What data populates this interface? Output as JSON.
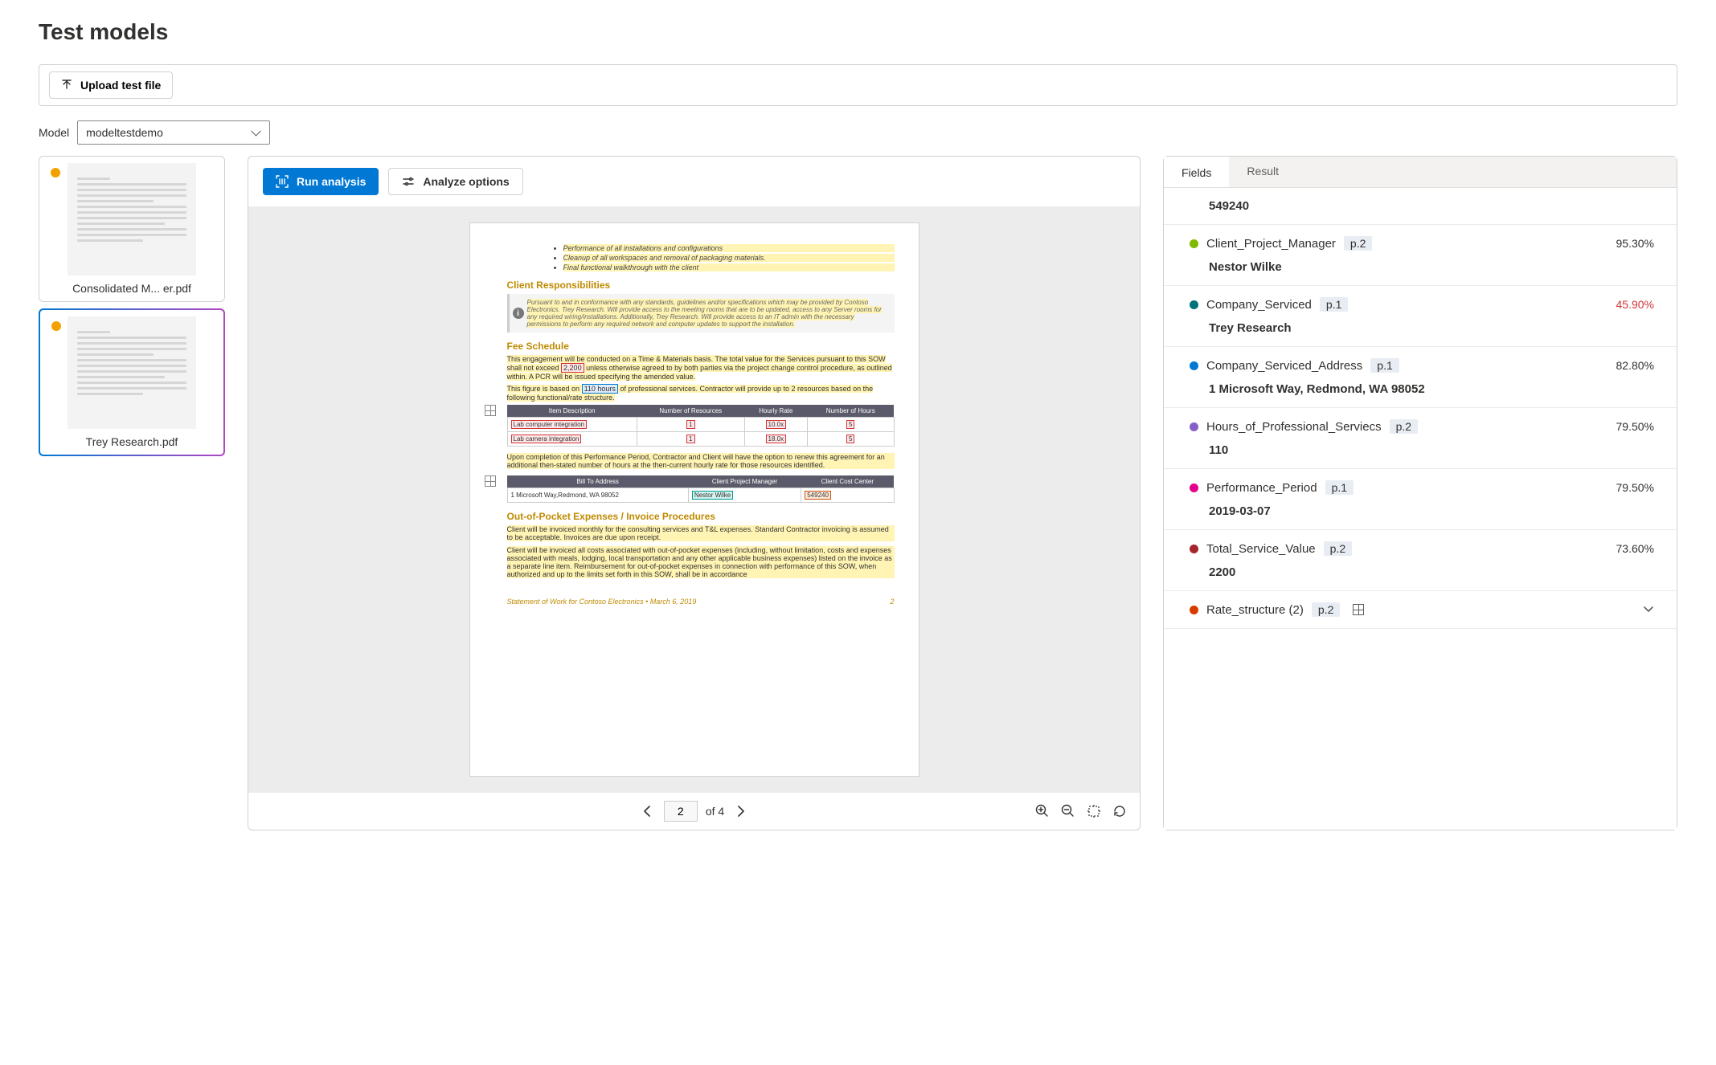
{
  "page_title": "Test models",
  "upload_label": "Upload test file",
  "model": {
    "label": "Model",
    "selected": "modeltestdemo"
  },
  "thumbs": [
    {
      "label": "Consolidated M...  er.pdf",
      "selected": false
    },
    {
      "label": "Trey Research.pdf",
      "selected": true
    }
  ],
  "viewer": {
    "run_label": "Run analysis",
    "options_label": "Analyze options",
    "page_current": "2",
    "page_of": "of 4"
  },
  "doc": {
    "bullets": [
      "Performance of all installations and configurations",
      "Cleanup of all workspaces and removal of packaging materials.",
      "Final functional walkthrough with the client"
    ],
    "h_client": "Client Responsibilities",
    "client_box": "Pursuant to and in conformance with any standards, guidelines and/or specifications which may be provided by Contoso Electronics. Trey Research. Will provide access to the meeting rooms that are to be updated, access to any Server rooms for any required wiring/installations. Additionally, Trey Research. Will provide access to an IT admin with the necessary permissions to perform any required network and computer updates to support the installation.",
    "h_fee": "Fee Schedule",
    "fee_p1_a": "This engagement will be conducted on a Time & Materials basis. The total value for the Services pursuant to this SOW shall not exceed ",
    "fee_p1_tag": "2,200",
    "fee_p1_b": " unless otherwise agreed to by both parties via the project change control procedure, as outlined within. A PCR will be issued specifying the amended value.",
    "fee_p2_a": "This figure is based on ",
    "fee_p2_tag": "110 hours",
    "fee_p2_b": " of professional services. Contractor will provide up to 2 resources based on the following functional/rate structure.",
    "t1_head": [
      "Item Description",
      "Number of Resources",
      "Hourly Rate",
      "Number of Hours"
    ],
    "t1_r1": [
      "Lab computer integration",
      "1",
      "10.0x",
      "5"
    ],
    "t1_r2": [
      "Lab camera integration",
      "1",
      "18.0x",
      "5"
    ],
    "fee_p3": "Upon completion of this Performance Period, Contractor and Client will have the option to renew this agreement for an additional then-stated number of hours at the then-current hourly rate for those resources identified.",
    "t2_head": [
      "Bill To Address",
      "Client Project Manager",
      "Client Cost Center"
    ],
    "t2_r1_addr": "1 Microsoft Way,Redmond, WA 98052",
    "t2_r1_pm": "Nestor Wilke",
    "t2_r1_cc": "549240",
    "h_oop": "Out-of-Pocket Expenses / Invoice Procedures",
    "oop_p1": "Client will be invoiced monthly for the consulting services and T&L expenses. Standard Contractor invoicing is assumed to be acceptable. Invoices are due upon receipt.",
    "oop_p2": "Client will be invoiced all costs associated with out-of-pocket expenses (including, without limitation, costs and expenses associated with meals, lodging, local transportation and any other applicable business expenses) listed on the invoice as a separate line item. Reimbursement for out-of-pocket expenses in connection with performance of this SOW, when authorized and up to the limits set forth in this SOW, shall be in accordance",
    "footer": "Statement of Work for Contoso Electronics • March 6, 2019",
    "footer_page": "2"
  },
  "panel": {
    "tabs": {
      "fields": "Fields",
      "result": "Result",
      "active": "fields"
    },
    "top_value": "549240",
    "fields": [
      {
        "color": "#7fba00",
        "name": "Client_Project_Manager",
        "page": "p.2",
        "conf": "95.30%",
        "low": false,
        "value": "Nestor Wilke"
      },
      {
        "color": "#00727a",
        "name": "Company_Serviced",
        "page": "p.1",
        "conf": "45.90%",
        "low": true,
        "value": "Trey Research"
      },
      {
        "color": "#0078d4",
        "name": "Company_Serviced_Address",
        "page": "p.1",
        "conf": "82.80%",
        "low": false,
        "value": "1 Microsoft Way, Redmond, WA 98052"
      },
      {
        "color": "#8661c5",
        "name": "Hours_of_Professional_Serviecs",
        "page": "p.2",
        "conf": "79.50%",
        "low": false,
        "value": "110"
      },
      {
        "color": "#e3008c",
        "name": "Performance_Period",
        "page": "p.1",
        "conf": "79.50%",
        "low": false,
        "value": "2019-03-07"
      },
      {
        "color": "#a4262c",
        "name": "Total_Service_Value",
        "page": "p.2",
        "conf": "73.60%",
        "low": false,
        "value": "2200"
      },
      {
        "color": "#d83b01",
        "name": "Rate_structure (2)",
        "page": "p.2",
        "conf": "",
        "low": false,
        "value": null,
        "table": true,
        "expandable": true
      }
    ]
  }
}
